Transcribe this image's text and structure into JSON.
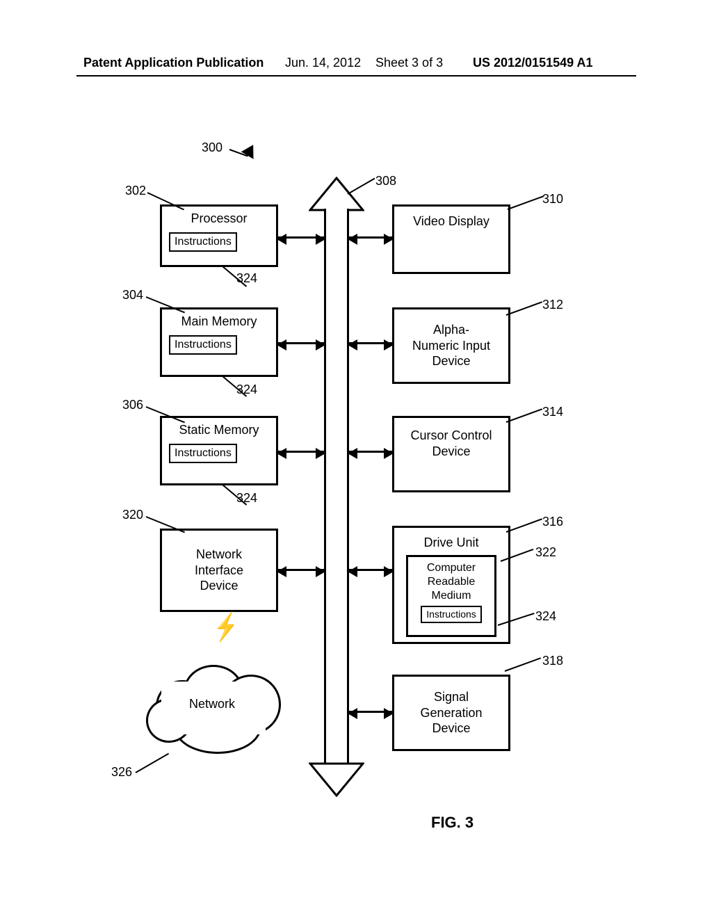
{
  "header": {
    "publication": "Patent Application Publication",
    "date": "Jun. 14, 2012",
    "sheet": "Sheet 3 of 3",
    "docno": "US 2012/0151549 A1"
  },
  "figure_label": "FIG. 3",
  "refs": {
    "r300": "300",
    "r302": "302",
    "r304": "304",
    "r306": "306",
    "r308": "308",
    "r310": "310",
    "r312": "312",
    "r314": "314",
    "r316": "316",
    "r318": "318",
    "r320": "320",
    "r322": "322",
    "r324a": "324",
    "r324b": "324",
    "r324c": "324",
    "r324d": "324",
    "r326": "326"
  },
  "blocks": {
    "processor": "Processor",
    "main_memory": "Main Memory",
    "static_memory": "Static Memory",
    "nic": "Network\nInterface\nDevice",
    "video": "Video Display",
    "alpha": "Alpha-\nNumeric Input\nDevice",
    "cursor": "Cursor Control\nDevice",
    "drive": "Drive Unit",
    "crm": "Computer\nReadable\nMedium",
    "sig": "Signal\nGeneration\nDevice",
    "instructions": "Instructions",
    "network": "Network"
  }
}
